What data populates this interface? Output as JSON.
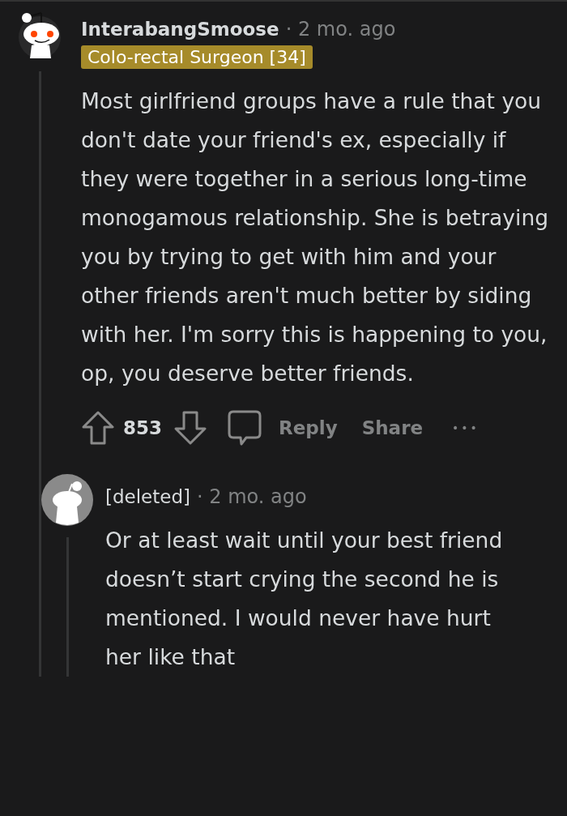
{
  "comment": {
    "author": "InterabangSmoose",
    "time": "· 2 mo. ago",
    "flair": "Colo-rectal Surgeon [34]",
    "body": "Most girlfriend groups have a rule that you don't date your friend's ex, especially if they were together in a serious long-time monogamous relationship. She is betraying you by trying to get with him and your other friends aren't much better by siding with her. I'm sorry this is happening to you, op, you deserve better friends.",
    "score": "853",
    "actions": [
      "Reply",
      "Share"
    ],
    "more": "•••"
  },
  "reply": {
    "author": "[deleted]",
    "time": "· 2 mo. ago",
    "body": "Or at least wait until your best friend doesn’t start crying the second he is mentioned. I would never have hurt her like that"
  }
}
